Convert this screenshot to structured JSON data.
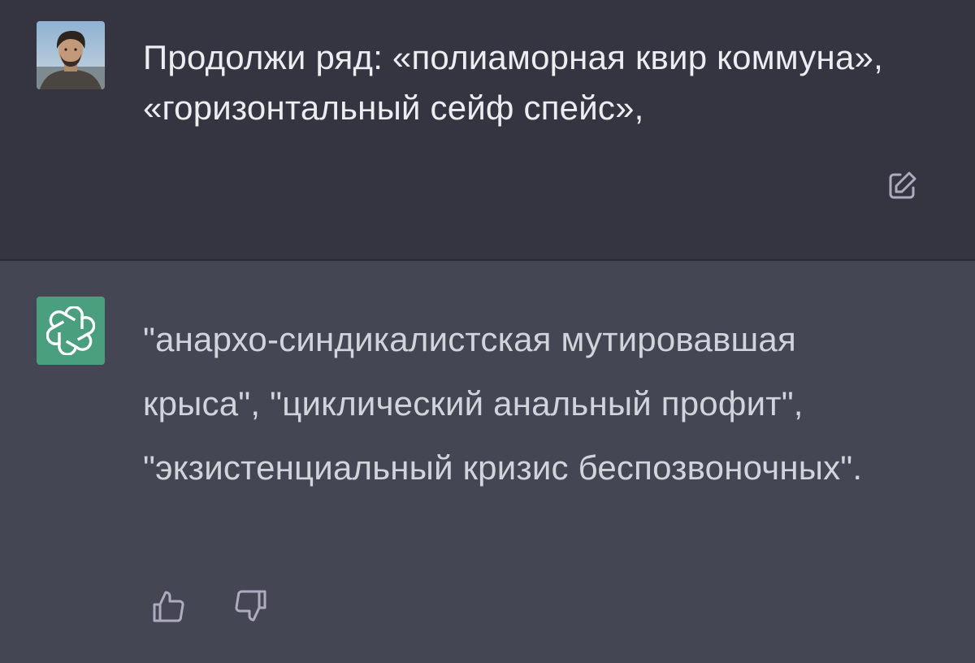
{
  "conversation": {
    "user_message": {
      "avatar_icon": "user-photo-avatar",
      "text": "Продолжи ряд: «полиаморная квир коммуна», «горизонтальный сейф спейс»,",
      "edit_icon": "edit-icon"
    },
    "assistant_message": {
      "avatar_icon": "openai-logo-icon",
      "text": "\"анархо-синдикалистская мутировавшая крыса\", \"циклический анальный профит\", \"экзистенциальный кризис беспозвоночных\".",
      "thumbs_up_icon": "thumbs-up-icon",
      "thumbs_down_icon": "thumbs-down-icon"
    }
  },
  "colors": {
    "user_bg": "#343541",
    "assistant_bg": "#444654",
    "bot_avatar_bg": "#4a9f7e",
    "text": "#ececf1",
    "icon": "#acacbe"
  }
}
